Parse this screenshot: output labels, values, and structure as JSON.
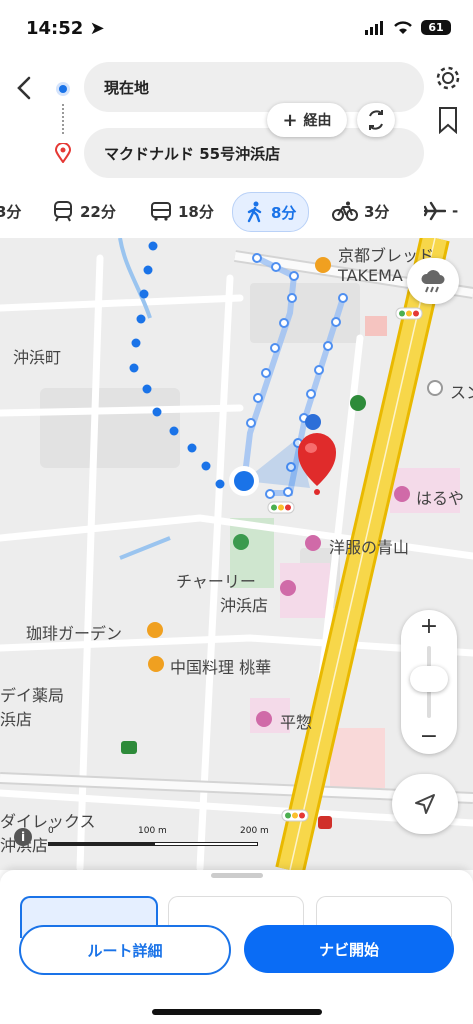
{
  "status": {
    "time": "14:52",
    "battery": "61"
  },
  "search": {
    "origin": "現在地",
    "destination": "マクドナルド 55号沖浜店",
    "waypoint_label": "経由"
  },
  "modes": [
    {
      "time": "3分"
    },
    {
      "time": "22分"
    },
    {
      "time": "18分"
    },
    {
      "time": "8分"
    },
    {
      "time": "3分"
    },
    {
      "time": "-"
    }
  ],
  "map": {
    "labels": {
      "okinohama": "沖浜町",
      "kyoto_bread": "京都ブレッド",
      "takema": "TAKEMA",
      "sun": "スン",
      "haruya": "はるや",
      "aoyama": "洋服の青山",
      "charley1": "チャーリー",
      "charley2": "沖浜店",
      "garden": "珈琲ガーデン",
      "chinese": "中国料理 桃華",
      "daikyoku1": "デイ薬局",
      "daikyoku2": "浜店",
      "heiwa": "平惣",
      "direx1": "ダイレックス",
      "direx2": "沖浜店"
    },
    "scale": {
      "zero": "0",
      "mid": "100 m",
      "end": "200 m"
    }
  },
  "actions": {
    "route_details": "ルート詳細",
    "start_nav": "ナビ開始"
  }
}
